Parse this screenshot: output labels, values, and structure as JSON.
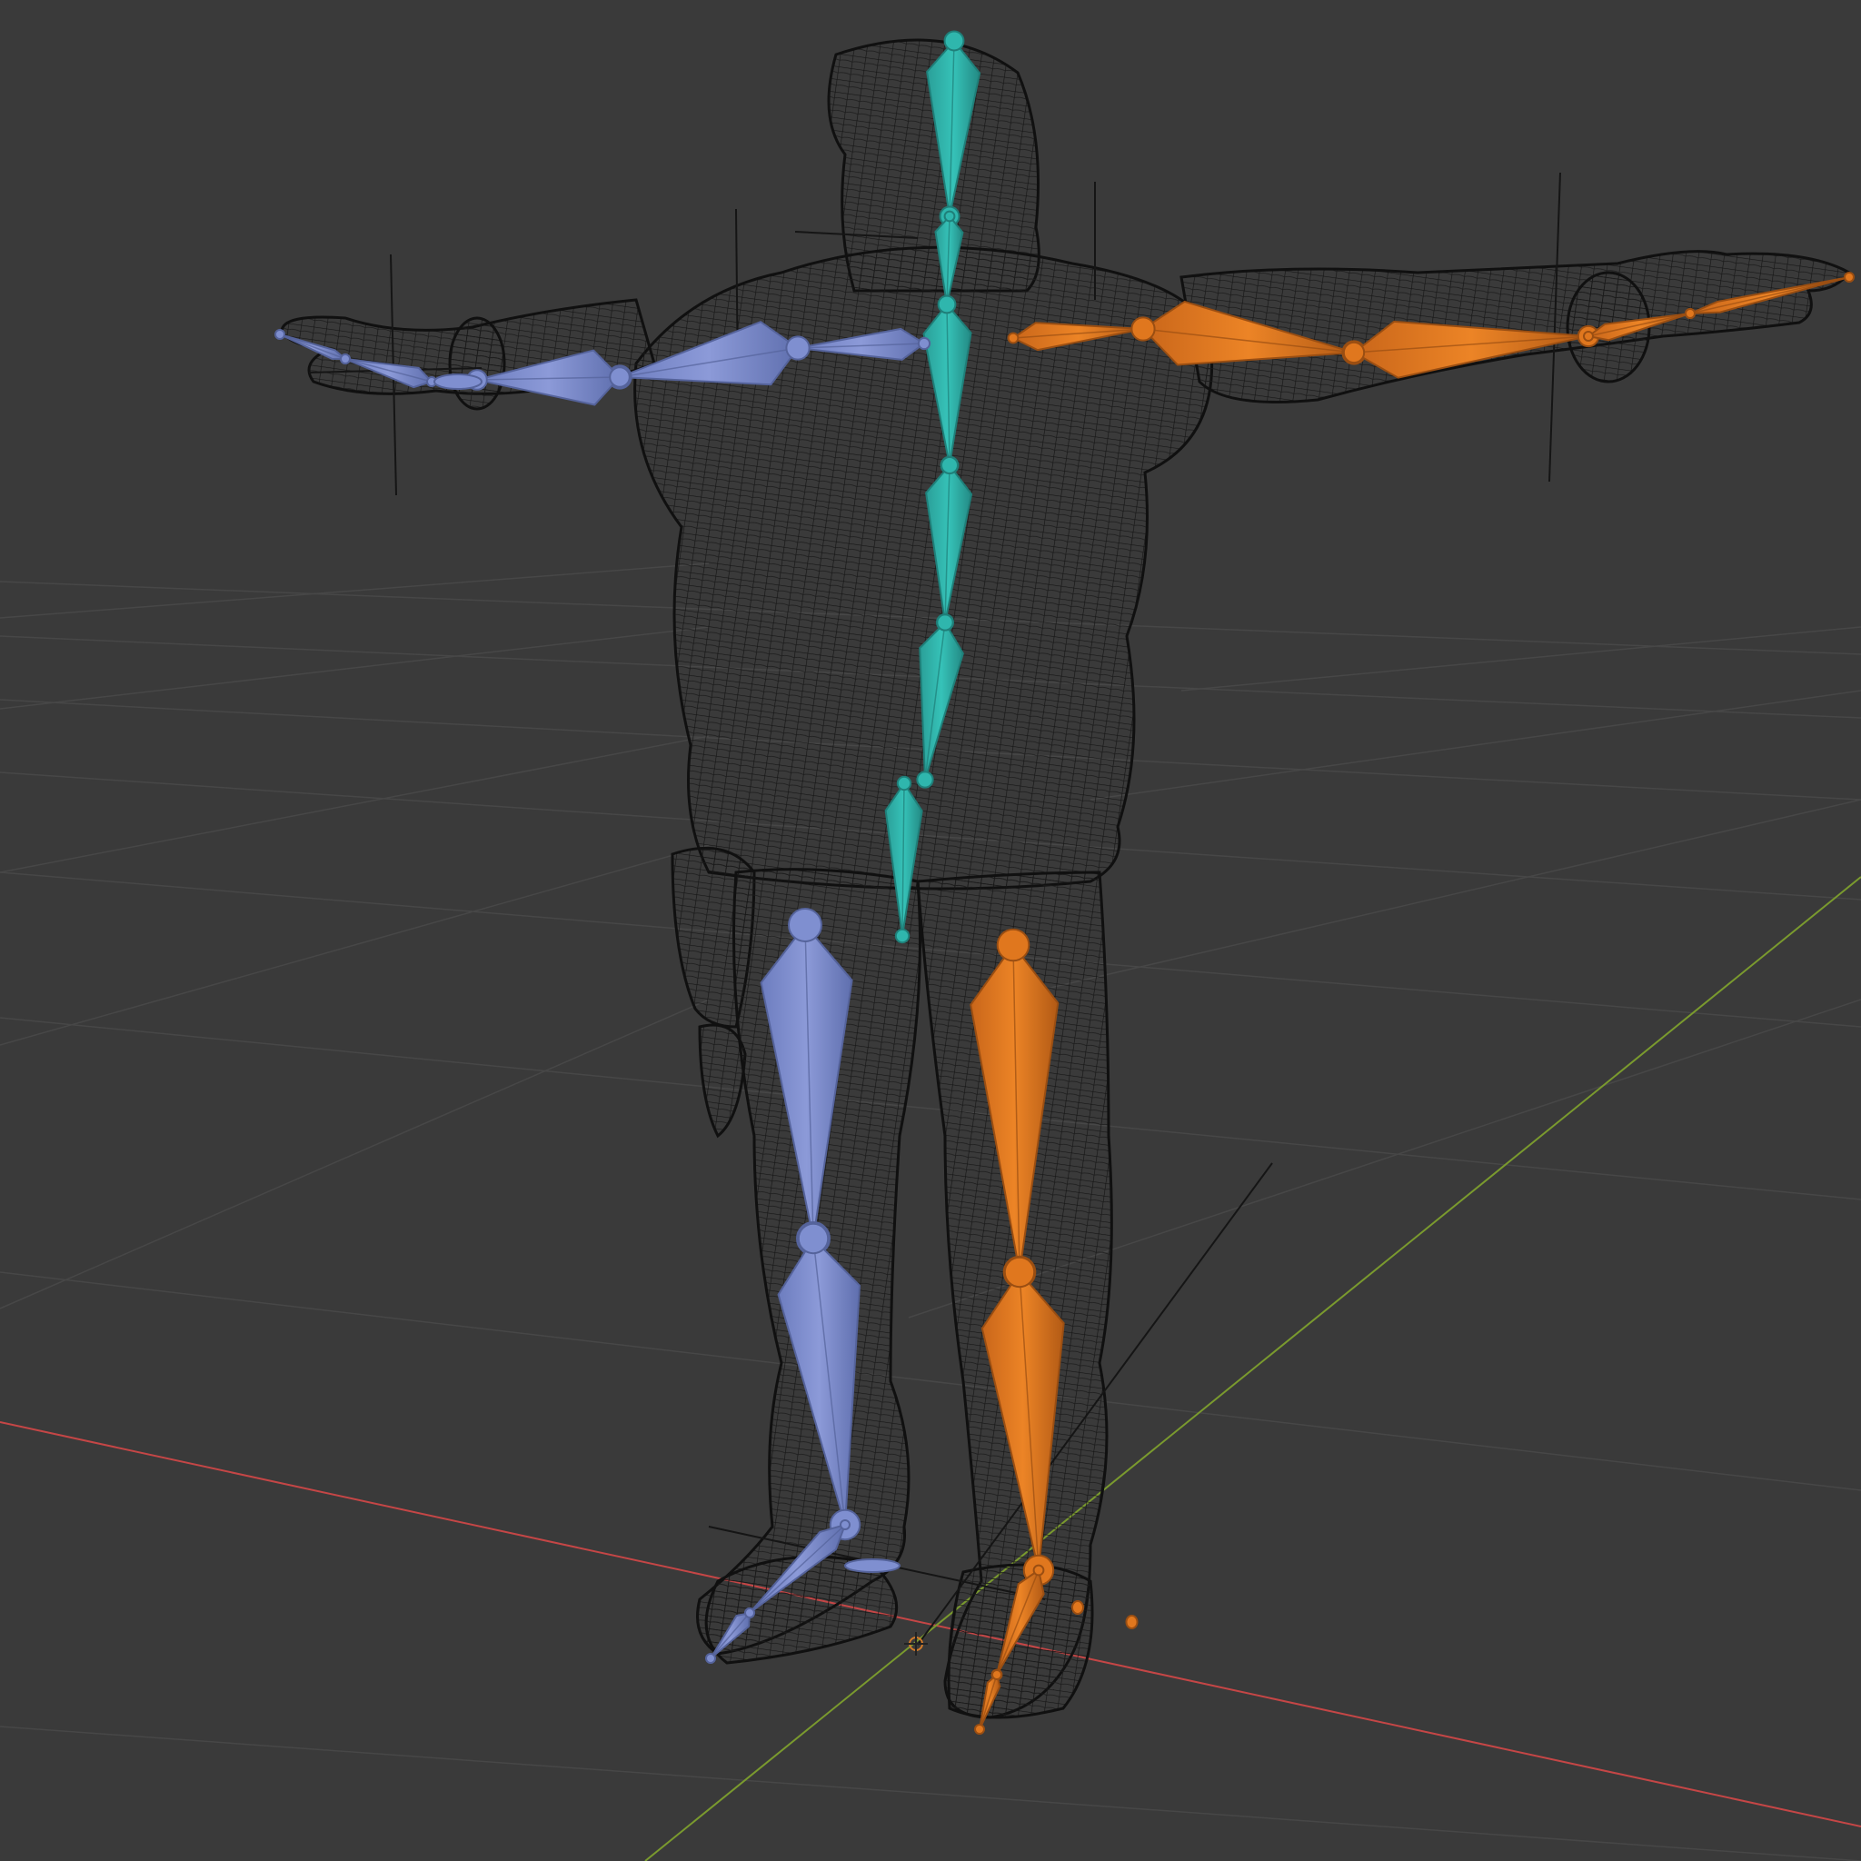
{
  "viewport": {
    "mode": "3D Viewport",
    "shading": "wireframe",
    "background_color": "#3a3a3a",
    "grid_color": "#4a4a4a",
    "x_axis_color": "#c54646",
    "y_axis_color": "#7a9a2e"
  },
  "armature": {
    "colors": {
      "center": "#2fb6ad",
      "left": "#7f8fd0",
      "right": "#e0771e",
      "mesh_wire": "#121212"
    },
    "bone_groups": {
      "spine": "center",
      "left_arm": "left",
      "right_arm": "right",
      "left_leg": "left",
      "right_leg": "right"
    }
  },
  "objects": {
    "mesh": "character-mesh",
    "armature": "armature-rig",
    "empties": [
      "empty-left-hand",
      "empty-left-shoulder",
      "empty-right-shoulder",
      "empty-right-hand",
      "empty-floor"
    ],
    "scene_origin": "origin-marker"
  }
}
